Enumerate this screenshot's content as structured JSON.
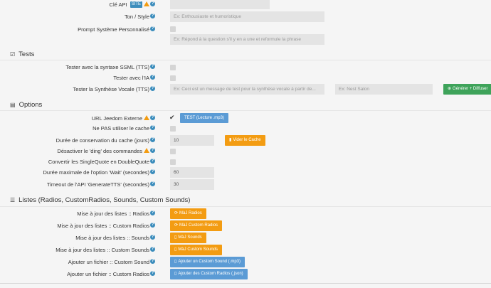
{
  "top": {
    "api_key_label": "Clé API",
    "api_key_badge": "SITE",
    "tone_label": "Ton / Style",
    "tone_placeholder": "Ex: Enthousiaste et humoristique",
    "prompt_label": "Prompt Système Personnalisé",
    "prompt_placeholder": "Ex: Répond à la question s'il y en a une et reformule la phrase"
  },
  "tests": {
    "title": "Tests",
    "ssml_label": "Tester avec la syntaxe SSML (TTS)",
    "ia_label": "Tester avec l'IA",
    "synth_label": "Tester la Synthèse Vocale (TTS)",
    "synth_placeholder": "Ex: Ceci est un message de test pour la synthèse vocale à partir de...",
    "device_placeholder": "Ex: Nest Salon",
    "generate_button": "Générer + Diffuser"
  },
  "options": {
    "title": "Options",
    "url_label": "URL Jeedom Externe",
    "test_button": "TEST (Lecture .mp3)",
    "nocache_label": "Ne PAS utiliser le cache",
    "cache_duration_label": "Durée de conservation du cache (jours)",
    "cache_duration_value": "10",
    "clear_cache_button": "Vider le Cache",
    "ding_label": "Désactiver le 'ding' des commandes",
    "quotes_label": "Convertir les SingleQuote en DoubleQuote",
    "wait_label": "Durée maximale de l'option 'Wait' (secondes)",
    "wait_value": "60",
    "timeout_label": "Timeout de l'API 'GenerateTTS' (secondes)",
    "timeout_value": "30"
  },
  "lists": {
    "title": "Listes (Radios, CustomRadios, Sounds, Custom Sounds)",
    "radios_label": "Mise à jour des listes :: Radios",
    "radios_button": "MàJ Radios",
    "custom_radios_label": "Mise à jour des listes :: Custom Radios",
    "custom_radios_button": "MàJ Custom Radios",
    "sounds_label": "Mise à jour des listes :: Sounds",
    "sounds_button": "MàJ Sounds",
    "custom_sounds_label": "Mise à jour des listes :: Custom Sounds",
    "custom_sounds_button": "MàJ Custom Sounds",
    "add_sound_label": "Ajouter un fichier :: Custom Sound",
    "add_sound_button": "Ajouter un Custom Sound (.mp3)",
    "add_radios_label": "Ajouter un fichier :: Custom Radios",
    "add_radios_button": "Ajouter des Custom Radios (.json)"
  },
  "icons": {
    "info": "info-circle-icon",
    "warning": "warning-icon",
    "check": "check-square-icon",
    "list": "list-icon",
    "refresh": "refresh-icon",
    "file": "file-icon"
  }
}
